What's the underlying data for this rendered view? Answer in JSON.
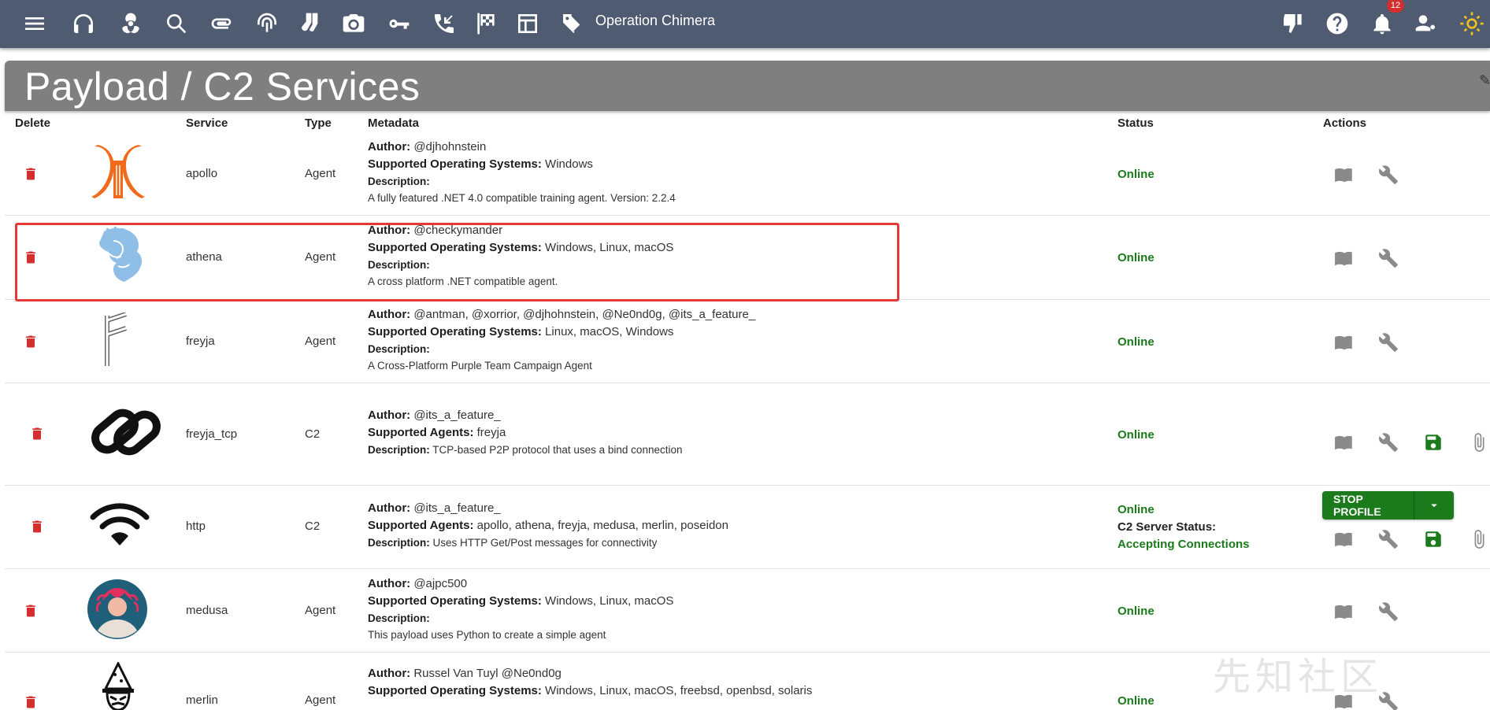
{
  "topbar": {
    "operation_name": "Operation Chimera",
    "notification_count": "12",
    "icons": [
      "menu-icon",
      "headphones-icon",
      "biohazard-icon",
      "search-icon",
      "paperclip-icon",
      "fingerprint-icon",
      "socks-icon",
      "camera-icon",
      "key-icon",
      "phone-callback-icon",
      "checkered-flag-icon",
      "table-icon",
      "tag-icon",
      "thumb-down-flag-icon",
      "help-icon",
      "bell-icon",
      "user-settings-icon",
      "sun-icon"
    ]
  },
  "page": {
    "title": "Payload / C2 Services"
  },
  "table": {
    "headers": {
      "delete": "Delete",
      "service": "Service",
      "type": "Type",
      "metadata": "Metadata",
      "status": "Status",
      "actions": "Actions"
    },
    "rows": [
      {
        "service": "apollo",
        "type": "Agent",
        "author_label": "Author:",
        "author": "@djhohnstein",
        "os_label": "Supported Operating Systems:",
        "os": "Windows",
        "desc_label": "Description:",
        "desc": "A fully featured .NET 4.0 compatible training agent. Version: 2.2.4",
        "status": "Online"
      },
      {
        "service": "athena",
        "type": "Agent",
        "author_label": "Author:",
        "author": "@checkymander",
        "os_label": "Supported Operating Systems:",
        "os": "Windows, Linux, macOS",
        "desc_label": "Description:",
        "desc": "A cross platform .NET compatible agent.",
        "status": "Online"
      },
      {
        "service": "freyja",
        "type": "Agent",
        "author_label": "Author:",
        "author": "@antman, @xorrior, @djhohnstein, @Ne0nd0g, @its_a_feature_",
        "os_label": "Supported Operating Systems:",
        "os": "Linux, macOS, Windows",
        "desc_label": "Description:",
        "desc": "A Cross-Platform Purple Team Campaign Agent",
        "status": "Online"
      },
      {
        "service": "freyja_tcp",
        "type": "C2",
        "author_label": "Author:",
        "author": "@its_a_feature_",
        "agents_label": "Supported Agents:",
        "agents": "freyja",
        "desc_label": "Description:",
        "desc": "TCP-based P2P protocol that uses a bind connection",
        "status": "Online"
      },
      {
        "service": "http",
        "type": "C2",
        "author_label": "Author:",
        "author": "@its_a_feature_",
        "agents_label": "Supported Agents:",
        "agents": "apollo, athena, freyja, medusa, merlin, poseidon",
        "desc_label": "Description:",
        "desc": "Uses HTTP Get/Post messages for connectivity",
        "status": "Online",
        "server_status_label": "C2 Server Status:",
        "server_status": "Accepting Connections",
        "stop_label": "STOP PROFILE"
      },
      {
        "service": "medusa",
        "type": "Agent",
        "author_label": "Author:",
        "author": "@ajpc500",
        "os_label": "Supported Operating Systems:",
        "os": "Windows, Linux, macOS",
        "desc_label": "Description:",
        "desc": "This payload uses Python to create a simple agent",
        "status": "Online"
      },
      {
        "service": "merlin",
        "type": "Agent",
        "author_label": "Author:",
        "author": "Russel Van Tuyl @Ne0nd0g",
        "os_label": "Supported Operating Systems:",
        "os": "Windows, Linux, macOS, freebsd, openbsd, solaris",
        "status": "Online"
      }
    ]
  },
  "watermark": "先知社区",
  "colors": {
    "topbar": "#4e5b71",
    "title_banner": "#7f7f7f",
    "online": "#1b7a1b",
    "delete": "#d32f2f",
    "highlight": "#e53935"
  }
}
